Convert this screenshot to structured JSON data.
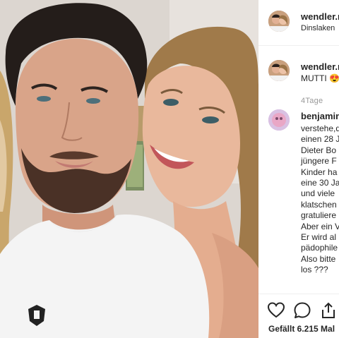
{
  "post": {
    "author": "wendler.m",
    "location": "Dinslaken",
    "caption_user": "wendler.m",
    "caption_text": "MUTTI 😍",
    "time": "4Tage"
  },
  "comment": {
    "user": "benjamin",
    "lines": [
      "verstehe,d",
      "einen 28 J",
      "Dieter Bo",
      "jüngere F",
      "Kinder ha",
      "eine 30 Ja",
      "und viele",
      "klatschen",
      "gratuliere",
      "Aber ein V",
      "Er wird al",
      "pädophile",
      "Also bitte",
      "los ???"
    ]
  },
  "actions": {
    "likes": "Gefällt 6.215 Mal",
    "icons": [
      "heart-icon",
      "comment-icon",
      "share-icon"
    ]
  },
  "colors": {
    "text": "#262626",
    "muted": "#999999",
    "border": "#efefef"
  }
}
